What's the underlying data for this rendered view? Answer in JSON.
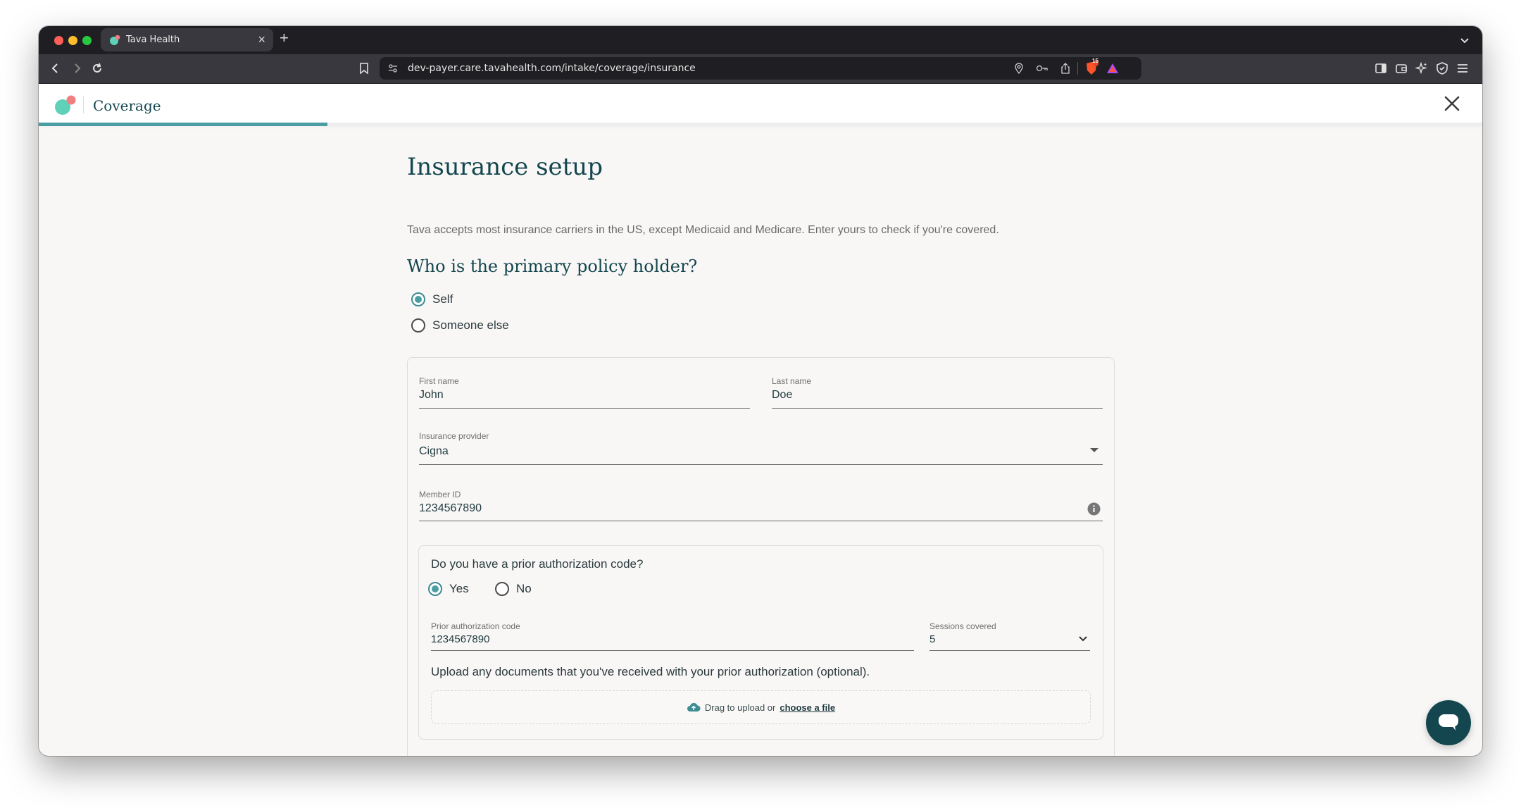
{
  "browser": {
    "tab_title": "Tava Health",
    "url": "dev-payer.care.tavahealth.com/intake/coverage/insurance",
    "new_tab_label": "+",
    "tab_close_label": "×",
    "shield_count": "15"
  },
  "header": {
    "title": "Coverage",
    "progress_fraction": 0.2
  },
  "page": {
    "title": "Insurance setup",
    "subtitle": "Tava accepts most insurance carriers in the US, except Medicaid and Medicare. Enter yours to check if you're covered.",
    "question": "Who is the primary policy holder?",
    "holder_options": [
      {
        "label": "Self",
        "selected": true
      },
      {
        "label": "Someone else",
        "selected": false
      }
    ]
  },
  "form": {
    "first_name": {
      "label": "First name",
      "value": "John"
    },
    "last_name": {
      "label": "Last name",
      "value": "Doe"
    },
    "provider": {
      "label": "Insurance provider",
      "value": "Cigna"
    },
    "member_id": {
      "label": "Member ID",
      "value": "1234567890"
    },
    "prior_auth": {
      "question": "Do you have a prior authorization code?",
      "options": [
        {
          "label": "Yes",
          "selected": true
        },
        {
          "label": "No",
          "selected": false
        }
      ],
      "code": {
        "label": "Prior authorization code",
        "value": "1234567890"
      },
      "sessions": {
        "label": "Sessions covered",
        "value": "5"
      },
      "upload_note": "Upload any documents that you've received with your prior authorization (optional).",
      "dropzone_text": "Drag to upload or",
      "dropzone_link": "choose a file"
    }
  },
  "colors": {
    "brand_dark": "#13464f",
    "brand_teal": "#4a9ea3",
    "logo_coral": "#f27f7f",
    "logo_mint": "#5fd1b8"
  }
}
